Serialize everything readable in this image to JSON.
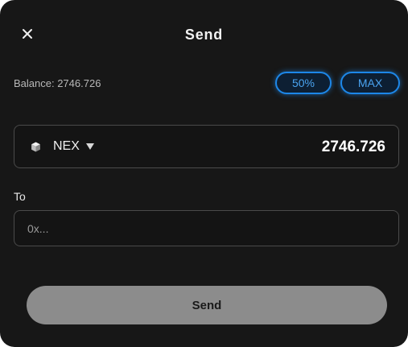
{
  "dialog": {
    "title": "Send",
    "close_icon": "close-icon"
  },
  "balance": {
    "text": "Balance: 2746.726"
  },
  "quick_amounts": {
    "half_label": "50%",
    "max_label": "MAX"
  },
  "amount_field": {
    "token_icon": "cube-icon",
    "token_symbol": "NEX",
    "dropdown_icon": "caret-down-icon",
    "value": "2746.726"
  },
  "recipient": {
    "label": "To",
    "placeholder": "0x..."
  },
  "send_button": {
    "label": "Send"
  },
  "colors": {
    "background": "#171717",
    "accent": "#1d87e8",
    "button_disabled": "#8c8c8c",
    "field_border": "#4a4a4a"
  }
}
